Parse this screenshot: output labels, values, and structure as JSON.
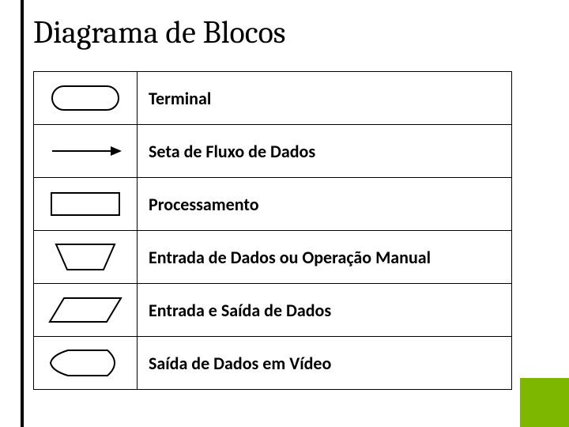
{
  "title": "Diagrama de Blocos",
  "chart_data": {
    "type": "table",
    "title": "Diagrama de Blocos",
    "rows": [
      {
        "symbol": "terminal",
        "label": "Terminal"
      },
      {
        "symbol": "flow-arrow",
        "label": "Seta de Fluxo de Dados"
      },
      {
        "symbol": "process",
        "label": "Processamento"
      },
      {
        "symbol": "manual-input",
        "label": "Entrada de Dados ou Operação Manual"
      },
      {
        "symbol": "io-data",
        "label": "Entrada e Saída de Dados"
      },
      {
        "symbol": "display",
        "label": "Saída de Dados em Vídeo"
      }
    ]
  },
  "symbols": {
    "terminal": "terminal-shape-icon",
    "flow-arrow": "flow-arrow-icon",
    "process": "process-rectangle-icon",
    "manual-input": "manual-input-trapezoid-icon",
    "io-data": "io-parallelogram-icon",
    "display": "display-shape-icon"
  },
  "colors": {
    "accent": "#7db700",
    "stroke": "#000000"
  }
}
